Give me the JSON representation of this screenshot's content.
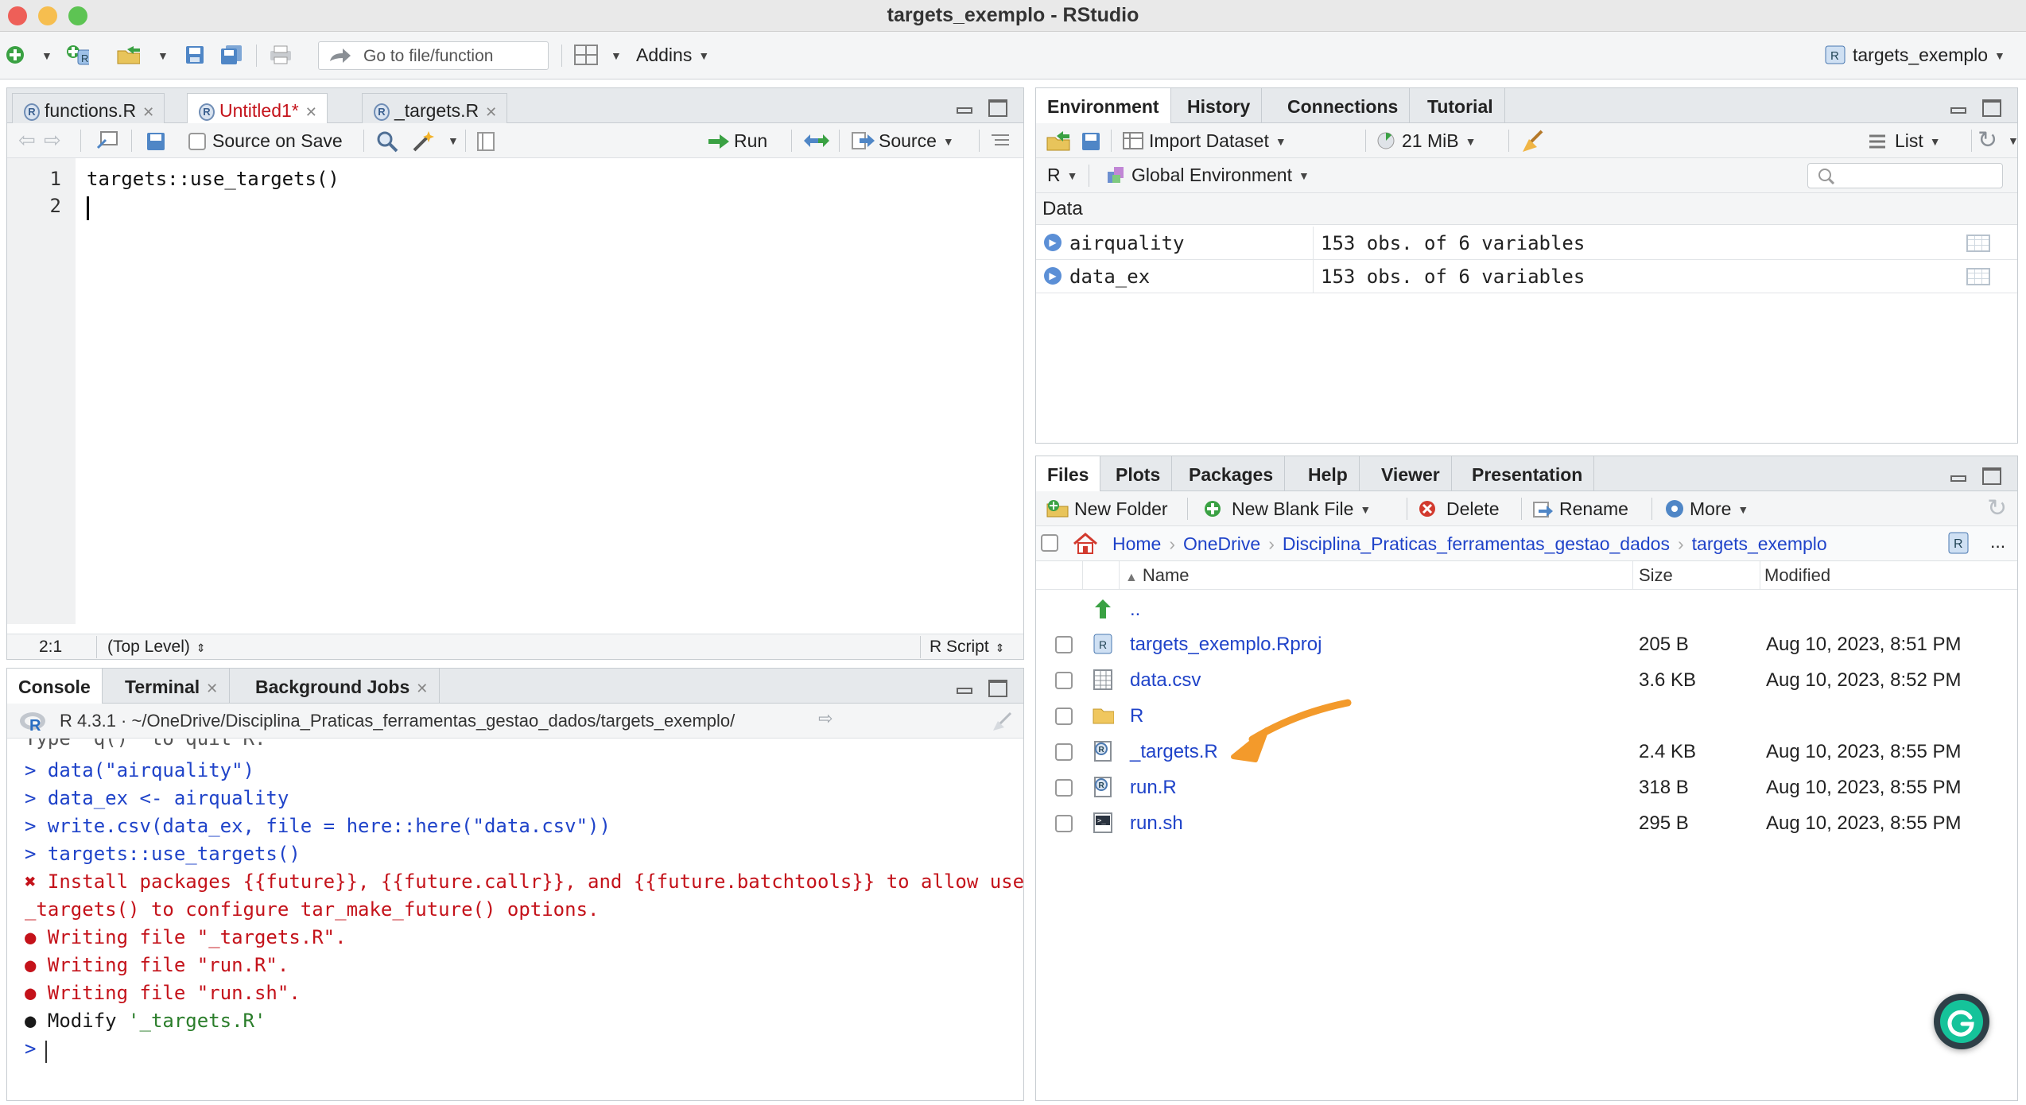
{
  "window": {
    "title": "targets_exemplo - RStudio"
  },
  "toolbar": {
    "goto_placeholder": "Go to file/function",
    "addins_label": "Addins",
    "project_label": "targets_exemplo"
  },
  "editor": {
    "tabs": [
      {
        "label": "functions.R",
        "modified": false
      },
      {
        "label": "Untitled1*",
        "modified": true
      },
      {
        "label": "_targets.R",
        "modified": false
      }
    ],
    "source_on_save_label": "Source on Save",
    "run_label": "Run",
    "source_label": "Source",
    "lines": [
      {
        "num": "1",
        "code": "targets::use_targets()"
      },
      {
        "num": "2",
        "code": ""
      }
    ],
    "status": {
      "position": "2:1",
      "scope": "(Top Level)",
      "filetype": "R Script"
    }
  },
  "console": {
    "tabs": [
      "Console",
      "Terminal",
      "Background Jobs"
    ],
    "header": "R 4.3.1 · ~/OneDrive/Disciplina_Praticas_ferramentas_gestao_dados/targets_exemplo/",
    "partial_top": "Type 'q()' to quit R.",
    "lines": [
      {
        "text": "> data(\"airquality\")",
        "style": "blue"
      },
      {
        "text": "> data_ex <- airquality",
        "style": "blue"
      },
      {
        "text": "> write.csv(data_ex, file = here::here(\"data.csv\"))",
        "style": "blue"
      },
      {
        "text": "> targets::use_targets()",
        "style": "blue"
      },
      {
        "text": "✖ Install packages {{future}}, {{future.callr}}, and {{future.batchtools}} to allow use",
        "style": "red"
      },
      {
        "text": "_targets() to configure tar_make_future() options.",
        "style": "red"
      },
      {
        "text": "● Writing file \"_targets.R\".",
        "style": "red"
      },
      {
        "text": "● Writing file \"run.R\".",
        "style": "red"
      },
      {
        "text": "● Writing file \"run.sh\".",
        "style": "red"
      }
    ],
    "modify_prefix": "● Modify ",
    "modify_target": "'_targets.R'",
    "prompt": ">"
  },
  "environment": {
    "tabs": [
      "Environment",
      "History",
      "Connections",
      "Tutorial"
    ],
    "import_dataset_label": "Import Dataset",
    "memory_label": "21 MiB",
    "list_label": "List",
    "language_label": "R",
    "scope_label": "Global Environment",
    "search_placeholder": "",
    "section_label": "Data",
    "rows": [
      {
        "name": "airquality",
        "value": "153 obs. of 6 variables"
      },
      {
        "name": "data_ex",
        "value": "153 obs. of 6 variables"
      }
    ]
  },
  "files": {
    "tabs": [
      "Files",
      "Plots",
      "Packages",
      "Help",
      "Viewer",
      "Presentation"
    ],
    "actions": {
      "new_folder": "New Folder",
      "new_blank_file": "New Blank File",
      "delete": "Delete",
      "rename": "Rename",
      "more": "More"
    },
    "breadcrumb": [
      "Home",
      "OneDrive",
      "Disciplina_Praticas_ferramentas_gestao_dados",
      "targets_exemplo"
    ],
    "overflow_label": "...",
    "columns": {
      "name": "Name",
      "size": "Size",
      "modified": "Modified"
    },
    "parent_label": "..",
    "rows": [
      {
        "name": "targets_exemplo.Rproj",
        "size": "205 B",
        "modified": "Aug 10, 2023, 8:51 PM",
        "icon": "rproj-icon"
      },
      {
        "name": "data.csv",
        "size": "3.6 KB",
        "modified": "Aug 10, 2023, 8:52 PM",
        "icon": "csv-file-icon"
      },
      {
        "name": "R",
        "size": "",
        "modified": "",
        "icon": "folder-icon"
      },
      {
        "name": "_targets.R",
        "size": "2.4 KB",
        "modified": "Aug 10, 2023, 8:55 PM",
        "icon": "r-file-icon"
      },
      {
        "name": "run.R",
        "size": "318 B",
        "modified": "Aug 10, 2023, 8:55 PM",
        "icon": "r-file-icon"
      },
      {
        "name": "run.sh",
        "size": "295 B",
        "modified": "Aug 10, 2023, 8:55 PM",
        "icon": "shell-file-icon"
      }
    ]
  },
  "colors": {
    "accent_arrow": "#f39a2b",
    "link_blue": "#1f43c9",
    "error_red": "#c4121a",
    "grammarly_green": "#15c39a"
  }
}
